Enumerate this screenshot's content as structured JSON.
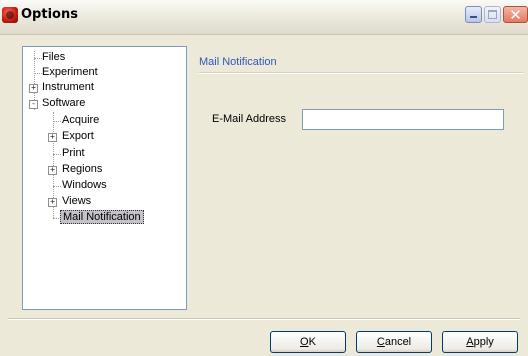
{
  "window": {
    "title": "Options",
    "app_icon": "red-application-icon"
  },
  "tree": {
    "items": [
      {
        "label": "Files",
        "level": 0,
        "expander": "none"
      },
      {
        "label": "Experiment",
        "level": 0,
        "expander": "none"
      },
      {
        "label": "Instrument",
        "level": 0,
        "expander": "+"
      },
      {
        "label": "Software",
        "level": 0,
        "expander": "-"
      },
      {
        "label": "Acquire",
        "level": 1,
        "expander": "none"
      },
      {
        "label": "Export",
        "level": 1,
        "expander": "+"
      },
      {
        "label": "Print",
        "level": 1,
        "expander": "none"
      },
      {
        "label": "Regions",
        "level": 1,
        "expander": "+"
      },
      {
        "label": "Windows",
        "level": 1,
        "expander": "none"
      },
      {
        "label": "Views",
        "level": 1,
        "expander": "+"
      },
      {
        "label": "Mail Notification",
        "level": 1,
        "expander": "none",
        "selected": true
      }
    ]
  },
  "panel": {
    "header": "Mail Notification",
    "email_label": "E-Mail Address",
    "email_value": "",
    "email_placeholder": ""
  },
  "buttons": {
    "ok": {
      "mnemonic": "O",
      "rest": "K"
    },
    "cancel": {
      "mnemonic": "C",
      "rest": "ancel"
    },
    "apply": {
      "mnemonic": "A",
      "rest": "pply"
    }
  },
  "colors": {
    "header_text": "#2a5ab8",
    "selection_bg": "#c4c2c8",
    "dialog_bg": "#ece9d8"
  }
}
